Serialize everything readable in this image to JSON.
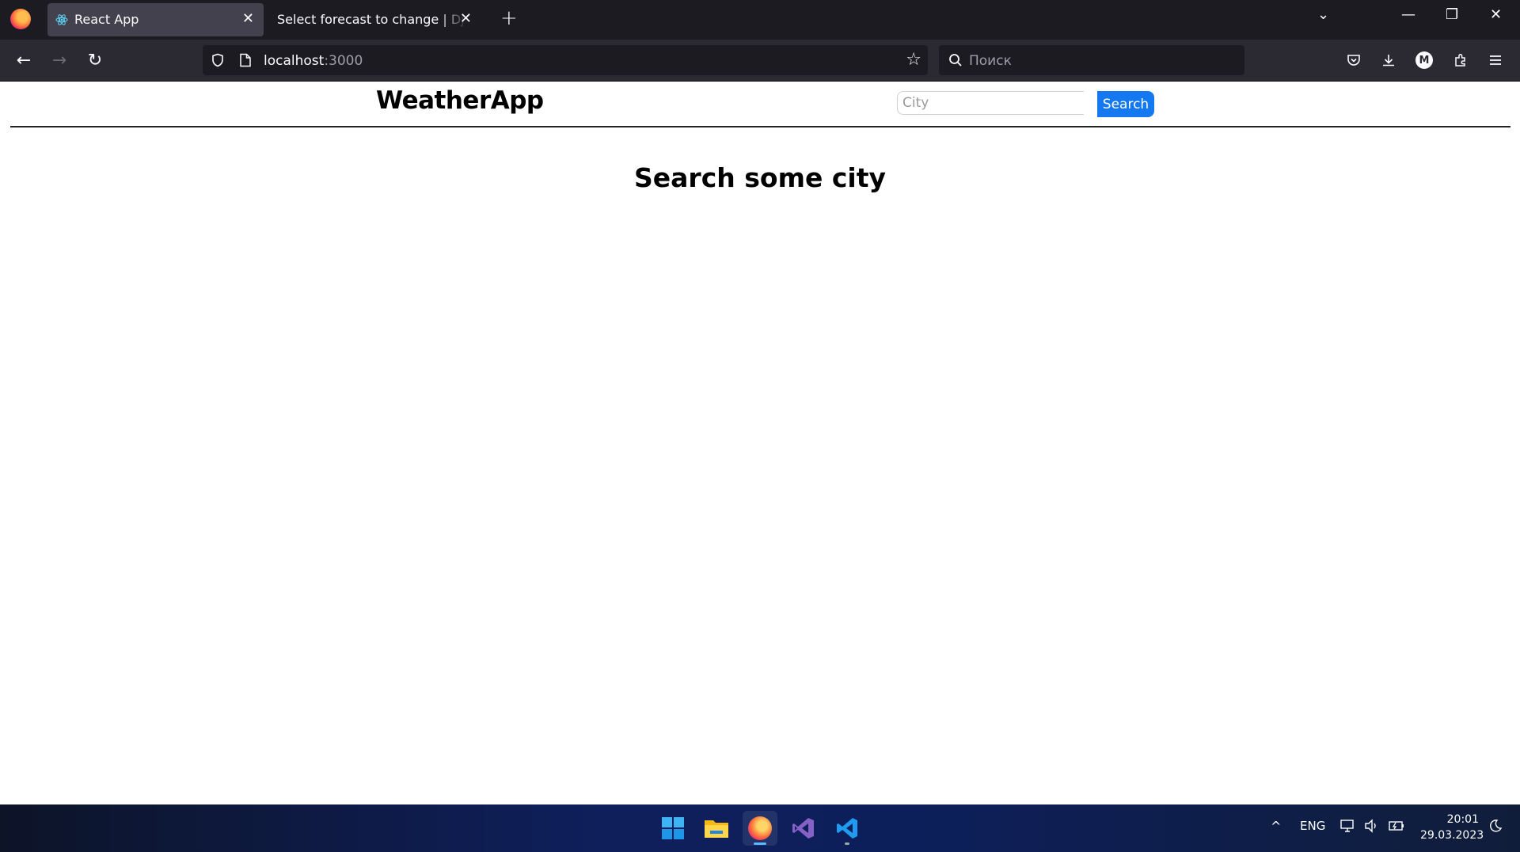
{
  "browser": {
    "tabs": [
      {
        "title": "React App",
        "active": true
      },
      {
        "title": "Select forecast to change | Django site admin",
        "active": false
      }
    ],
    "url_host": "localhost",
    "url_port": ":3000",
    "search_placeholder": "Поиск",
    "profile_initial": "M"
  },
  "app": {
    "brand": "WeatherApp",
    "city_placeholder": "City",
    "search_button": "Search",
    "heading": "Search some city"
  },
  "taskbar": {
    "language": "ENG",
    "time": "20:01",
    "date": "29.03.2023"
  },
  "colors": {
    "accent": "#1479f0",
    "chrome_dark": "#1c1b22",
    "toolbar": "#2b2a33"
  }
}
